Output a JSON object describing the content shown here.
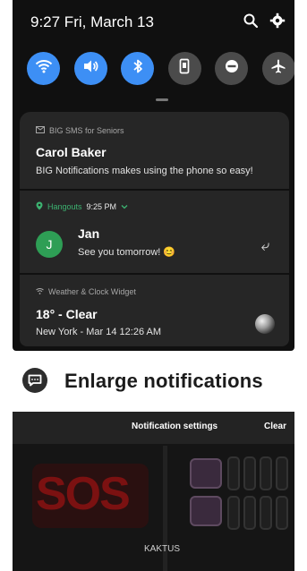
{
  "status_bar": {
    "time_date": "9:27  Fri, March 13"
  },
  "quick_settings": [
    {
      "icon": "wifi-icon",
      "state": "on"
    },
    {
      "icon": "sound-icon",
      "state": "on"
    },
    {
      "icon": "bluetooth-icon",
      "state": "on"
    },
    {
      "icon": "rotate-icon",
      "state": "off"
    },
    {
      "icon": "do-not-disturb-icon",
      "state": "off"
    },
    {
      "icon": "airplane-icon",
      "state": "off"
    }
  ],
  "notifications": [
    {
      "app": "BIG SMS for Seniors",
      "title": "Carol Baker",
      "text": "BIG Notifications makes using the phone so easy!"
    },
    {
      "app": "Hangouts",
      "time": "9:25 PM",
      "avatar": "J",
      "title": "Jan",
      "text": "See you tomorrow! 😊"
    },
    {
      "app": "Weather & Clock Widget",
      "title": "18° - Clear",
      "text": "New York - Mar 14  12:26 AM"
    }
  ],
  "banner": {
    "text": "Enlarge notifications"
  },
  "notification_bar": {
    "settings": "Notification settings",
    "clear": "Clear"
  },
  "home_screen": {
    "sos": "SOS",
    "label": "KAKTUS"
  },
  "colors": {
    "accent": "#3d8ff5",
    "hangouts_green": "#2e9e55"
  }
}
